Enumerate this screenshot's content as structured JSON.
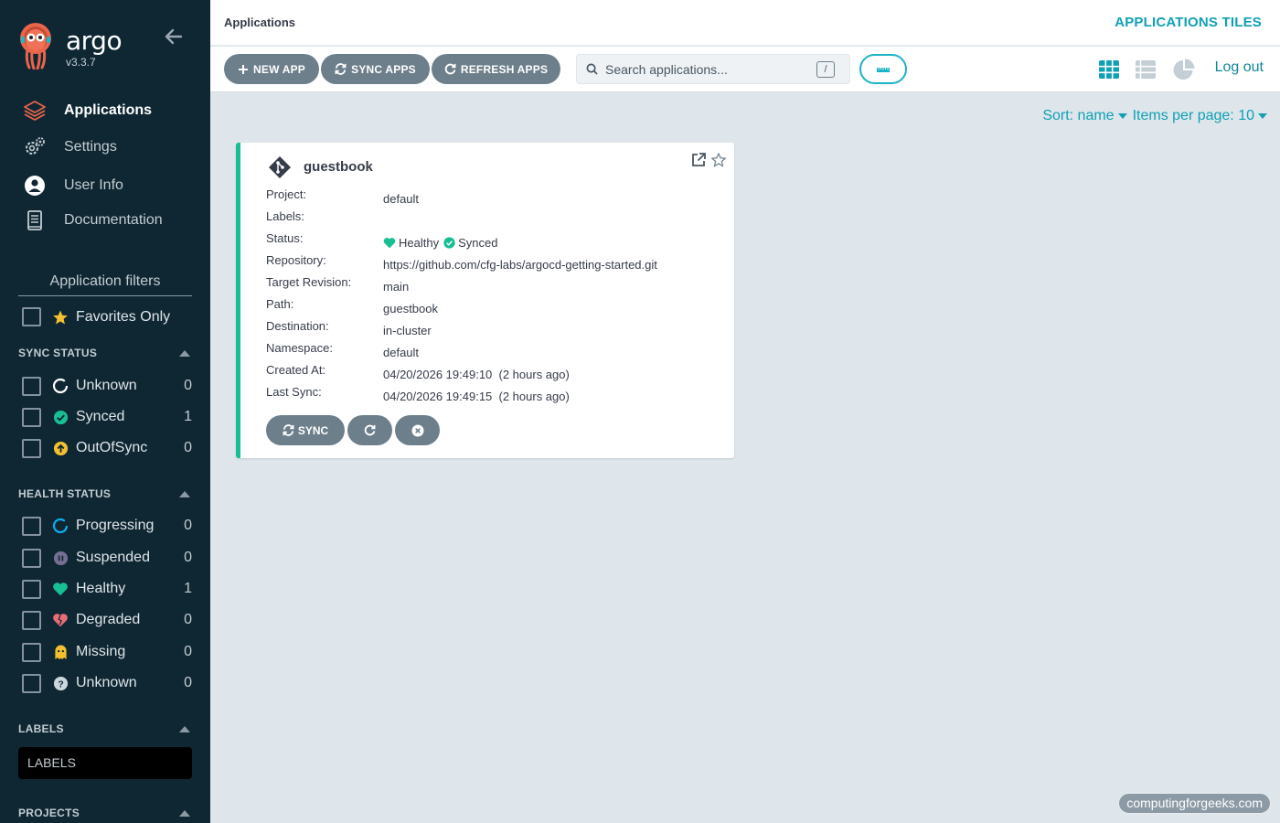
{
  "sidebar": {
    "brand": "argo",
    "version": "v3.3.7",
    "nav": [
      {
        "label": "Applications",
        "icon": "layers-icon"
      },
      {
        "label": "Settings",
        "icon": "gears-icon"
      },
      {
        "label": "User Info",
        "icon": "user-circle-icon"
      },
      {
        "label": "Documentation",
        "icon": "book-icon"
      }
    ],
    "filters_title": "Application filters",
    "favorites_label": "Favorites Only",
    "sync_status": {
      "title": "SYNC STATUS",
      "items": [
        {
          "label": "Unknown",
          "count": "0"
        },
        {
          "label": "Synced",
          "count": "1"
        },
        {
          "label": "OutOfSync",
          "count": "0"
        }
      ]
    },
    "health_status": {
      "title": "HEALTH STATUS",
      "items": [
        {
          "label": "Progressing",
          "count": "0"
        },
        {
          "label": "Suspended",
          "count": "0"
        },
        {
          "label": "Healthy",
          "count": "1"
        },
        {
          "label": "Degraded",
          "count": "0"
        },
        {
          "label": "Missing",
          "count": "0"
        },
        {
          "label": "Unknown",
          "count": "0"
        }
      ]
    },
    "labels": {
      "title": "LABELS",
      "placeholder": "LABELS"
    },
    "projects": {
      "title": "PROJECTS"
    }
  },
  "header": {
    "breadcrumb": "Applications",
    "view_title": "APPLICATIONS TILES"
  },
  "toolbar": {
    "new_app": "NEW APP",
    "sync_apps": "SYNC APPS",
    "refresh_apps": "REFRESH APPS",
    "search_placeholder": "Search applications...",
    "search_shortcut": "/",
    "logout": "Log out"
  },
  "sort": {
    "sort_label": "Sort: name",
    "per_page_label": "Items per page: 10"
  },
  "app_card": {
    "name": "guestbook",
    "fields": [
      {
        "key": "Project:",
        "value": "default"
      },
      {
        "key": "Labels:",
        "value": ""
      },
      {
        "key": "Status:",
        "health": "Healthy",
        "sync": "Synced"
      },
      {
        "key": "Repository:",
        "value": "https://github.com/cfg-labs/argocd-getting-started.git"
      },
      {
        "key": "Target Revision:",
        "value": "main"
      },
      {
        "key": "Path:",
        "value": "guestbook"
      },
      {
        "key": "Destination:",
        "value": "in-cluster"
      },
      {
        "key": "Namespace:",
        "value": "default"
      },
      {
        "key": "Created At:",
        "value": "04/20/2026 19:49:10  (2 hours ago)"
      },
      {
        "key": "Last Sync:",
        "value": "04/20/2026 19:49:15  (2 hours ago)"
      }
    ],
    "sync_button": "SYNC"
  },
  "watermark": "computingforgeeks.com",
  "colors": {
    "sidebar_bg": "#0f2733",
    "accent": "#10a0b4",
    "healthy": "#18be94",
    "button": "#6d7f8b",
    "outofsync": "#f4c030",
    "degraded": "#e96d76",
    "suspended": "#766f94",
    "progressing": "#0dadea"
  }
}
